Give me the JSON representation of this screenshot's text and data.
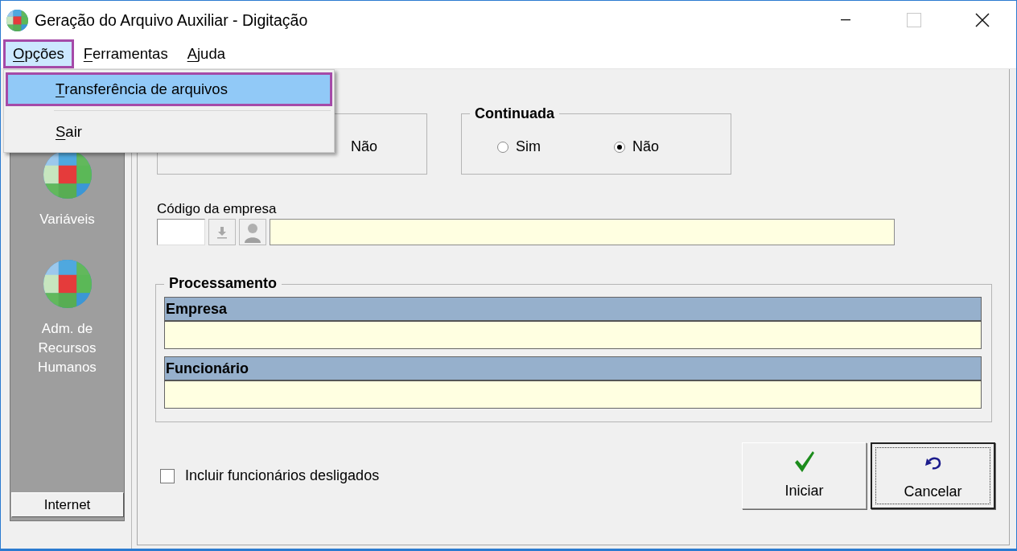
{
  "window": {
    "title": "Geração do Arquivo Auxiliar - Digitação",
    "controls": [
      {
        "kind": "minimize",
        "disabled": false
      },
      {
        "kind": "maximize",
        "disabled": true
      },
      {
        "kind": "close",
        "disabled": false
      }
    ]
  },
  "menu_bar": [
    {
      "label": "Opções",
      "access_key_underlined": true,
      "selected": true,
      "annotated": true
    },
    {
      "label": "Ferramentas",
      "access_key_underlined": true,
      "selected": false,
      "annotated": false
    },
    {
      "label": "Ajuda",
      "access_key_underlined": true,
      "selected": false,
      "annotated": false
    }
  ],
  "open_menu": {
    "items": [
      {
        "kind": "item",
        "label": "Transferência de arquivos",
        "access_key_underlined": true,
        "selected": true,
        "annotated": true
      },
      {
        "kind": "separator"
      },
      {
        "kind": "item",
        "label": "Sair",
        "access_key_underlined": true,
        "selected": false,
        "annotated": false
      }
    ]
  },
  "sidebar": {
    "items": [
      {
        "label": "Variáveis"
      },
      {
        "label": "Adm. de Recursos Humanos"
      }
    ],
    "footer_button": "Internet"
  },
  "form": {
    "groups": [
      {
        "options": [
          {
            "label": "Não"
          }
        ]
      },
      {
        "title": "Continuada",
        "options": [
          {
            "label": "Sim",
            "selected": false
          },
          {
            "label": "Não",
            "selected": true
          }
        ]
      }
    ],
    "company_code": {
      "label": "Código da empresa"
    },
    "processing": {
      "title": "Processamento",
      "sections": [
        {
          "title": "Empresa"
        },
        {
          "title": "Funcionário"
        }
      ]
    },
    "include_dismissed": {
      "label": "Incluir funcionários desligados",
      "checked": false
    },
    "buttons": [
      {
        "kind": "confirm",
        "label": "Iniciar",
        "focused": false
      },
      {
        "kind": "cancel",
        "label": "Cancelar",
        "focused": true
      }
    ]
  }
}
